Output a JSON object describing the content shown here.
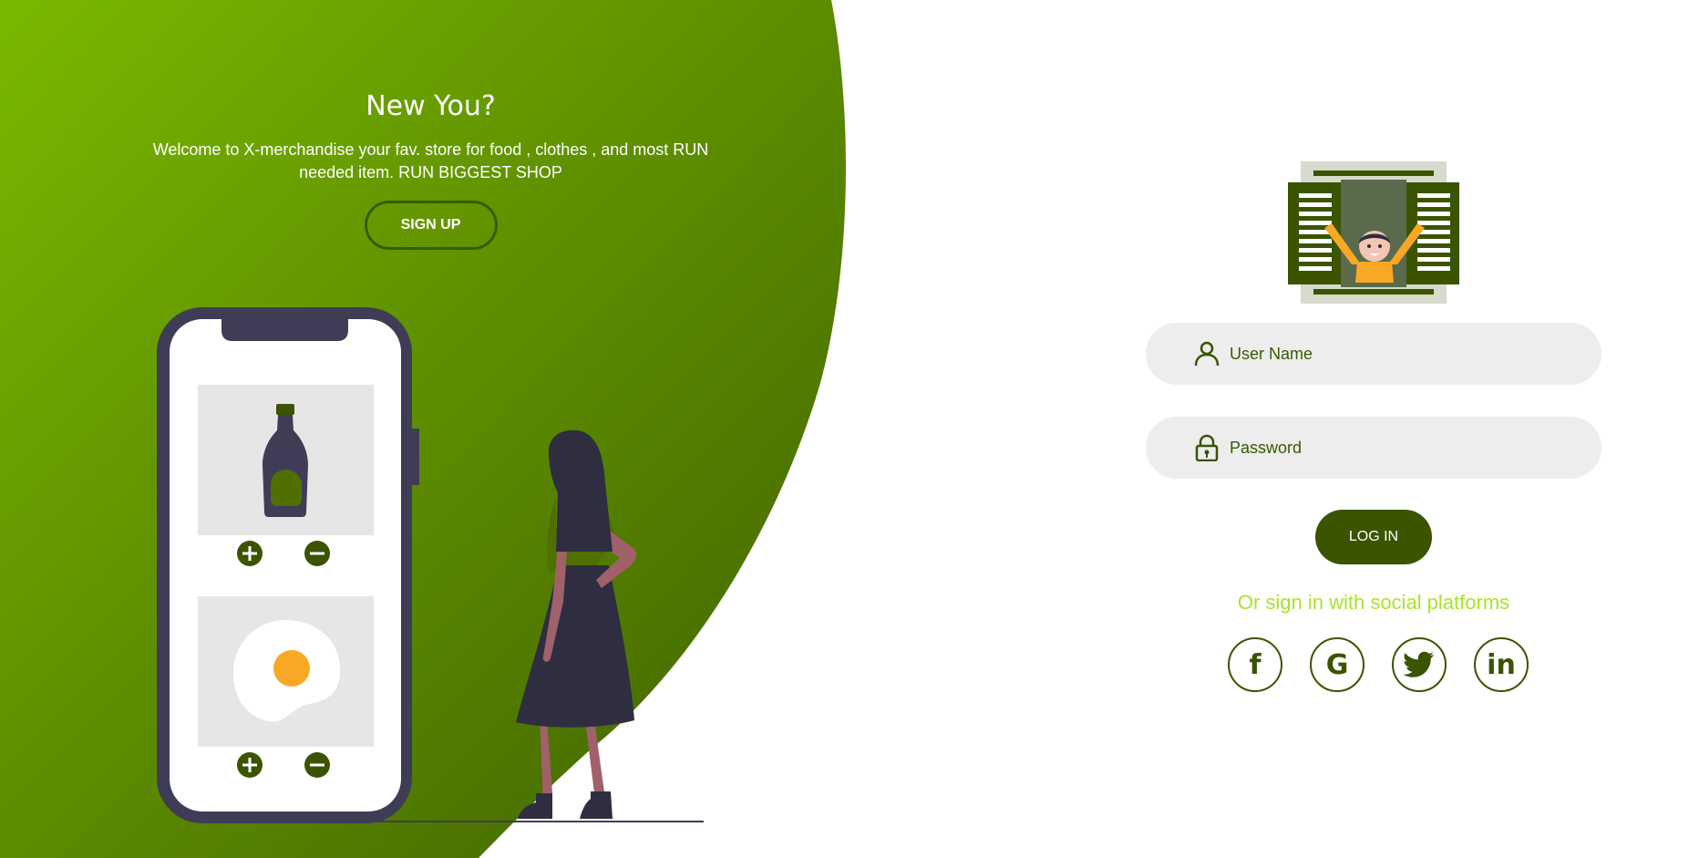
{
  "colors": {
    "gradient_start": "#7ab800",
    "gradient_end": "#3f6000",
    "accent_dark": "#3a5400",
    "social_text": "#a9e22b",
    "field_bg": "#ededed",
    "phone_frame": "#3f3d56",
    "person_dark": "#2f2e41",
    "skin": "#a0616a",
    "egg_yolk": "#f9a826",
    "card_bg": "#e6e6e6"
  },
  "left_panel": {
    "title": "New You?",
    "description": "Welcome to X-merchandise your fav. store for food , clothes , and most RUN needed item. RUN BIGGEST SHOP",
    "signup_label": "SIGN UP"
  },
  "illustration": {
    "plus_icon": "plus-circle-icon",
    "minus_icon": "minus-circle-icon",
    "product_1": "bottle",
    "product_2": "fried-egg"
  },
  "login_form": {
    "username_placeholder": "User Name",
    "password_placeholder": "Password",
    "login_label": "LOG IN",
    "social_text": "Or sign in with social platforms",
    "social": [
      {
        "name": "facebook",
        "glyph": "f",
        "icon": "facebook-icon"
      },
      {
        "name": "google",
        "glyph": "G",
        "icon": "google-icon"
      },
      {
        "name": "twitter",
        "glyph": "",
        "icon": "twitter-icon"
      },
      {
        "name": "linkedin",
        "glyph": "in",
        "icon": "linkedin-icon"
      }
    ]
  }
}
